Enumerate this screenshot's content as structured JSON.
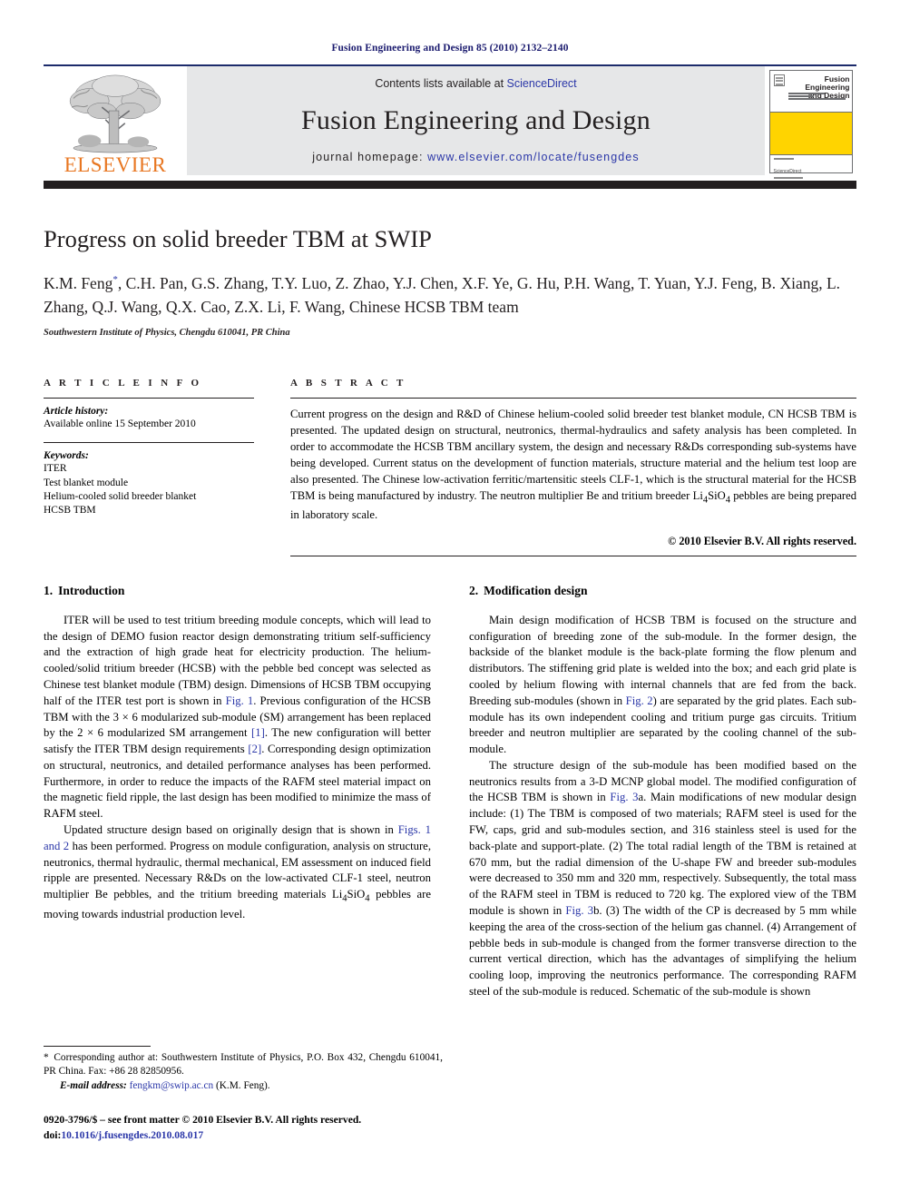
{
  "running_head": "Fusion Engineering and Design 85 (2010) 2132–2140",
  "masthead": {
    "contents_prefix": "Contents lists available at ",
    "sciencedirect": "ScienceDirect",
    "journal_title": "Fusion Engineering and Design",
    "homepage_prefix": "journal homepage: ",
    "homepage_url": "www.elsevier.com/locate/fusengdes",
    "publisher_wordmark": "ELSEVIER",
    "cover_title_line1": "Fusion Engineering",
    "cover_title_line2": "and Design",
    "link_color": "#2b37a8",
    "accent_orange": "#E87722",
    "cover_yellow": "#FFD400",
    "masthead_band": "#e6e7e8"
  },
  "article": {
    "title": "Progress on solid breeder TBM at SWIP",
    "authors": "K.M. Feng*, C.H. Pan, G.S. Zhang, T.Y. Luo, Z. Zhao, Y.J. Chen, X.F. Ye, G. Hu, P.H. Wang, T. Yuan, Y.J. Feng, B. Xiang, L. Zhang, Q.J. Wang, Q.X. Cao, Z.X. Li, F. Wang, Chinese HCSB TBM team",
    "affiliation": "Southwestern Institute of Physics, Chengdu 610041, PR China"
  },
  "article_info": {
    "heading": "A R T I C L E    I N F O",
    "history_label": "Article history:",
    "history_value": "Available online 15 September 2010",
    "keywords_label": "Keywords:",
    "keywords": [
      "ITER",
      "Test blanket module",
      "Helium-cooled solid breeder blanket",
      "HCSB TBM"
    ]
  },
  "abstract": {
    "heading": "A B S T R A C T",
    "text": "Current progress on the design and R&D of Chinese helium-cooled solid breeder test blanket module, CN HCSB TBM is presented. The updated design on structural, neutronics, thermal-hydraulics and safety analysis has been completed. In order to accommodate the HCSB TBM ancillary system, the design and necessary R&Ds corresponding sub-systems have being developed. Current status on the development of function materials, structure material and the helium test loop are also presented. The Chinese low-activation ferritic/martensitic steels CLF-1, which is the structural material for the HCSB TBM is being manufactured by industry. The neutron multiplier Be and tritium breeder Li4SiO4 pebbles are being prepared in laboratory scale.",
    "copyright": "© 2010 Elsevier B.V. All rights reserved."
  },
  "sections": {
    "intro": {
      "number": "1.",
      "title": "Introduction",
      "para1": "ITER will be used to test tritium breeding module concepts, which will lead to the design of DEMO fusion reactor design demonstrating tritium self-sufficiency and the extraction of high grade heat for electricity production. The helium-cooled/solid tritium breeder (HCSB) with the pebble bed concept was selected as Chinese test blanket module (TBM) design. Dimensions of HCSB TBM occupying half of the ITER test port is shown in Fig. 1. Previous configuration of the HCSB TBM with the 3 × 6 modularized sub-module (SM) arrangement has been replaced by the 2 × 6 modularized SM arrangement [1]. The new configuration will better satisfy the ITER TBM design requirements [2]. Corresponding design optimization on structural, neutronics, and detailed performance analyses has been performed. Furthermore, in order to reduce the impacts of the RAFM steel material impact on the magnetic field ripple, the last design has been modified to minimize the mass of RAFM steel.",
      "para2": "Updated structure design based on originally design that is shown in Figs. 1 and 2 has been performed. Progress on module configuration, analysis on structure, neutronics, thermal hydraulic, thermal mechanical, EM assessment on induced field ripple are presented. Necessary R&Ds on the low-activated CLF-1 steel, neutron multiplier Be pebbles, and the tritium breeding materials Li4SiO4 pebbles are moving towards industrial production level."
    },
    "modification": {
      "number": "2.",
      "title": "Modification design",
      "para1": "Main design modification of HCSB TBM is focused on the structure and configuration of breeding zone of the sub-module. In the former design, the backside of the blanket module is the back-plate forming the flow plenum and distributors. The stiffening grid plate is welded into the box; and each grid plate is cooled by helium flowing with internal channels that are fed from the back. Breeding sub-modules (shown in Fig. 2) are separated by the grid plates. Each sub-module has its own independent cooling and tritium purge gas circuits. Tritium breeder and neutron multiplier are separated by the cooling channel of the sub-module.",
      "para2": "The structure design of the sub-module has been modified based on the neutronics results from a 3-D MCNP global model. The modified configuration of the HCSB TBM is shown in Fig. 3a. Main modifications of new modular design include: (1) The TBM is composed of two materials; RAFM steel is used for the FW, caps, grid and sub-modules section, and 316 stainless steel is used for the back-plate and support-plate. (2) The total radial length of the TBM is retained at 670 mm, but the radial dimension of the U-shape FW and breeder sub-modules were decreased to 350 mm and 320 mm, respectively. Subsequently, the total mass of the RAFM steel in TBM is reduced to 720 kg. The explored view of the TBM module is shown in Fig. 3b. (3) The width of the CP is decreased by 5 mm while keeping the area of the cross-section of the helium gas channel. (4) Arrangement of pebble beds in sub-module is changed from the former transverse direction to the current vertical direction, which has the advantages of simplifying the helium cooling loop, improving the neutronics performance. The corresponding RAFM steel of the sub-module is reduced. Schematic of the sub-module is shown"
    }
  },
  "footnotes": {
    "corresponding": "* Corresponding author at: Southwestern Institute of Physics, P.O. Box 432, Chengdu 610041, PR China. Fax: +86 28 82850956.",
    "email_label": "E-mail address:",
    "email": "fengkm@swip.ac.cn",
    "email_suffix": "(K.M. Feng).",
    "issn_line": "0920-3796/$ – see front matter © 2010 Elsevier B.V. All rights reserved.",
    "doi_label": "doi:",
    "doi_value": "10.1016/j.fusengdes.2010.08.017"
  }
}
